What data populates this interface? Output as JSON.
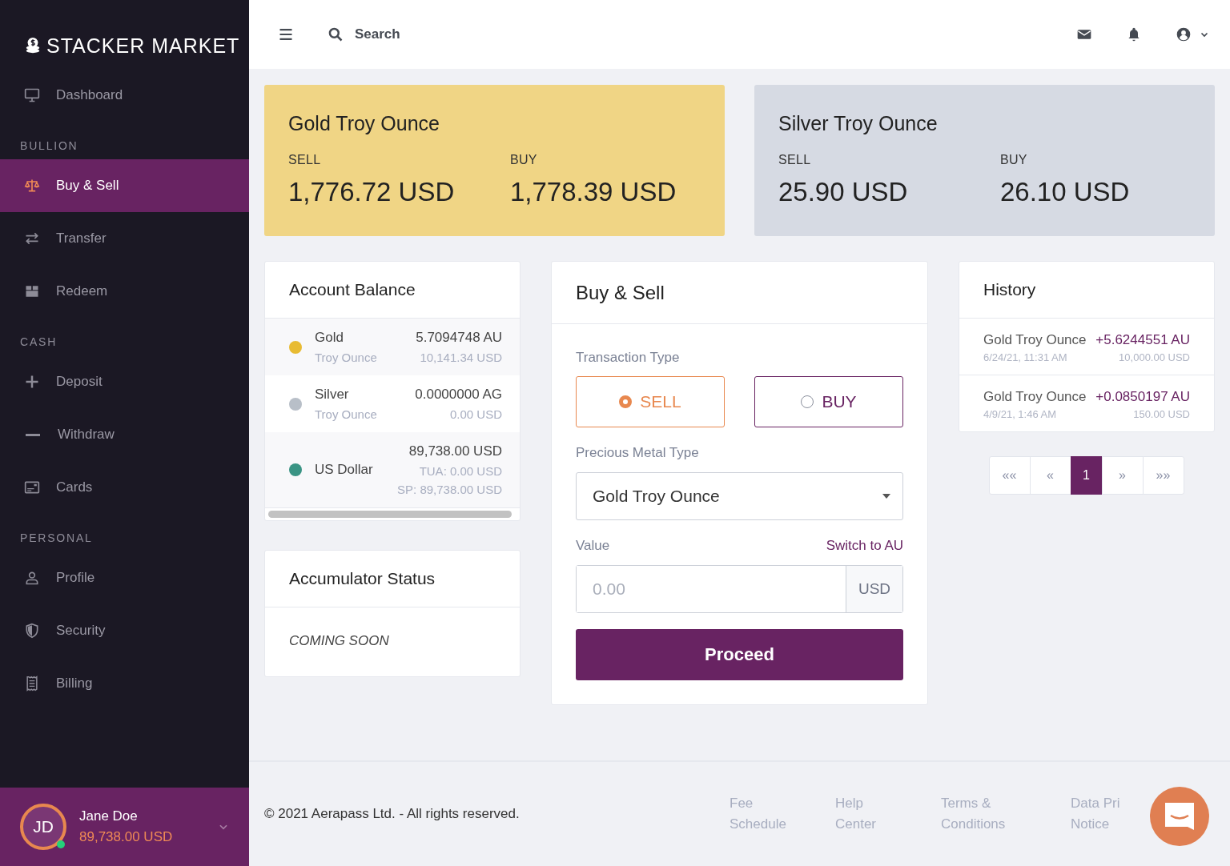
{
  "brand": {
    "name": "STACKER MARKET"
  },
  "sidebar": {
    "sections": [
      {
        "items": [
          {
            "label": "Dashboard",
            "selected": false
          }
        ]
      },
      {
        "title": "BULLION",
        "items": [
          {
            "label": "Buy & Sell",
            "selected": true
          },
          {
            "label": "Transfer",
            "selected": false
          },
          {
            "label": "Redeem",
            "selected": false
          }
        ]
      },
      {
        "title": "CASH",
        "items": [
          {
            "label": "Deposit",
            "selected": false
          },
          {
            "label": "Withdraw",
            "selected": false
          },
          {
            "label": "Cards",
            "selected": false
          }
        ]
      },
      {
        "title": "PERSONAL",
        "items": [
          {
            "label": "Profile",
            "selected": false
          },
          {
            "label": "Security",
            "selected": false
          },
          {
            "label": "Billing",
            "selected": false
          }
        ]
      }
    ],
    "user": {
      "initials": "JD",
      "name": "Jane Doe",
      "balance": "89,738.00 USD",
      "online": true
    }
  },
  "topbar": {
    "search": {
      "placeholder": "Search"
    }
  },
  "price_cards": [
    {
      "title": "Gold Troy Ounce",
      "color": "#f0d585",
      "sell_label": "SELL",
      "sell": "1,776.72 USD",
      "buy_label": "BUY",
      "buy": "1,778.39 USD"
    },
    {
      "title": "Silver Troy Ounce",
      "color": "#d6dae3",
      "sell_label": "SELL",
      "sell": "25.90 USD",
      "buy_label": "BUY",
      "buy": "26.10 USD"
    }
  ],
  "account_balance": {
    "title": "Account Balance",
    "rows": [
      {
        "name": "Gold",
        "sub": "Troy Ounce",
        "color": "#e8bb33",
        "amount": "5.7094748 AU",
        "details": [
          "10,141.34 USD"
        ]
      },
      {
        "name": "Silver",
        "sub": "Troy Ounce",
        "color": "#b8bfc8",
        "amount": "0.0000000 AG",
        "details": [
          "0.00 USD"
        ]
      },
      {
        "name": "US Dollar",
        "color": "#3a9484",
        "amount": "89,738.00 USD",
        "details": [
          "TUA: 0.00 USD",
          "SP: 89,738.00 USD"
        ]
      }
    ]
  },
  "accumulator": {
    "title": "Accumulator Status",
    "message": "COMING SOON"
  },
  "buy_sell": {
    "title": "Buy & Sell",
    "transaction_label": "Transaction Type",
    "options": [
      {
        "label": "SELL",
        "selected": true
      },
      {
        "label": "BUY",
        "selected": false
      }
    ],
    "metal_label": "Precious Metal Type",
    "metal": "Gold Troy Ounce",
    "value_label": "Value",
    "switch_link": "Switch to AU",
    "value": {
      "placeholder": "0.00"
    },
    "unit": "USD",
    "proceed": "Proceed"
  },
  "history": {
    "title": "History",
    "items": [
      {
        "name": "Gold Troy Ounce",
        "amount": "+5.6244551 AU",
        "date": "6/24/21, 11:31 AM",
        "usd": "10,000.00 USD"
      },
      {
        "name": "Gold Troy Ounce",
        "amount": "+0.0850197 AU",
        "date": "4/9/21, 1:46 AM",
        "usd": "150.00 USD"
      }
    ],
    "pages": [
      {
        "label": "««",
        "selected": false
      },
      {
        "label": "«",
        "selected": false
      },
      {
        "label": "1",
        "selected": true
      },
      {
        "label": "»",
        "selected": false
      },
      {
        "label": "»»",
        "selected": false
      }
    ]
  },
  "footer": {
    "copyright": "© 2021 Aerapass Ltd. - All rights reserved.",
    "links": [
      "Fee Schedule",
      "Help Center",
      "Terms & Conditions",
      "Data Pri Notice"
    ]
  }
}
